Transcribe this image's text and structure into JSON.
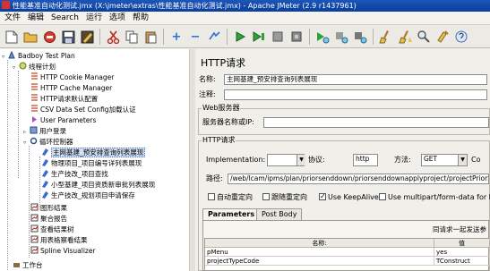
{
  "window": {
    "title": "性能基准自动化测试.jmx (X:\\jmeter\\extras\\性能基准自动化测试.jmx) - Apache JMeter (2.9 r1437961)"
  },
  "menu": [
    "文件",
    "编辑",
    "Search",
    "运行",
    "选项",
    "帮助"
  ],
  "toolbar": {
    "icons": [
      "new-icon",
      "open-icon",
      "stop-record-icon",
      "save-icon",
      "save-as-icon",
      "cut-icon",
      "copy-icon",
      "paste-icon",
      "expand-icon",
      "collapse-icon",
      "toggle-icon",
      "start-icon",
      "start-no-pause-icon",
      "stop-icon",
      "shutdown-icon",
      "remote-start-icon",
      "remote-stop-icon",
      "remote-exit-icon",
      "clear-icon",
      "clear-all-icon",
      "search-icon"
    ]
  },
  "tree": {
    "nodes": [
      {
        "label": "Badboy Test Plan",
        "icon": "test-plan-icon"
      },
      {
        "label": "线程计划",
        "icon": "thread-group-icon"
      },
      {
        "label": "HTTP Cookie Manager",
        "icon": "config-element-icon"
      },
      {
        "label": "HTTP Cache Manager",
        "icon": "config-element-icon"
      },
      {
        "label": "HTTP请求默认配置",
        "icon": "config-element-icon"
      },
      {
        "label": "CSV Data Set Config加载认证",
        "icon": "config-element-icon"
      },
      {
        "label": "User Parameters",
        "icon": "preprocessor-icon"
      },
      {
        "label": "用户登录",
        "icon": "controller-icon"
      },
      {
        "label": "循环控制器",
        "icon": "loop-controller-icon"
      },
      {
        "label": "主网基建_预安排查询列表展现",
        "icon": "sampler-icon"
      },
      {
        "label": "物理项目_项目编号详列表展现",
        "icon": "sampler-icon"
      },
      {
        "label": "生产技改_项目查找",
        "icon": "sampler-icon"
      },
      {
        "label": "小型基建_项目资质新审批列表展现",
        "icon": "sampler-icon"
      },
      {
        "label": "生产技改_规划项目申请保存",
        "icon": "sampler-icon"
      },
      {
        "label": "图形结果",
        "icon": "listener-icon"
      },
      {
        "label": "聚合报告",
        "icon": "listener-icon"
      },
      {
        "label": "查看结果树",
        "icon": "listener-icon"
      },
      {
        "label": "用表格察看结果",
        "icon": "listener-icon"
      },
      {
        "label": "Spline Visualizer",
        "icon": "listener-icon"
      },
      {
        "label": "工作台",
        "icon": "workbench-icon"
      }
    ]
  },
  "panel": {
    "title": "HTTP请求",
    "name_label": "名称:",
    "name_value": "主网基建_预安排查询列表展现",
    "comment_label": "注释:",
    "comment_value": "",
    "web_server_group": "Web服务器",
    "server_label": "服务器名称或IP:",
    "server_value": "",
    "http_group": "HTTP请求",
    "impl_label": "Implementation:",
    "impl_value": "",
    "protocol_label": "协议:",
    "protocol_value": "http",
    "method_label": "方法:",
    "method_value": "GET",
    "content_label": "Co",
    "path_label": "路径:",
    "path_value": "/web/lcam/ipms/plan/priorsenddown/priorsenddownapplyproject/projectPriorSendDown",
    "checkboxes": [
      {
        "label": "自动重定向",
        "checked": false
      },
      {
        "label": "跟随重定向",
        "checked": false
      },
      {
        "label": "Use KeepAlive",
        "checked": true
      },
      {
        "label": "Use multipart/form-data for P",
        "checked": false
      }
    ],
    "tabs": [
      "Parameters",
      "Post Body"
    ],
    "params_caption": "同请求一起发送参",
    "table": {
      "headers": [
        "名称:",
        "值"
      ],
      "rows": [
        [
          "pMenu",
          "yes"
        ],
        [
          "projectTypeCode",
          "TConstruct"
        ]
      ]
    }
  }
}
